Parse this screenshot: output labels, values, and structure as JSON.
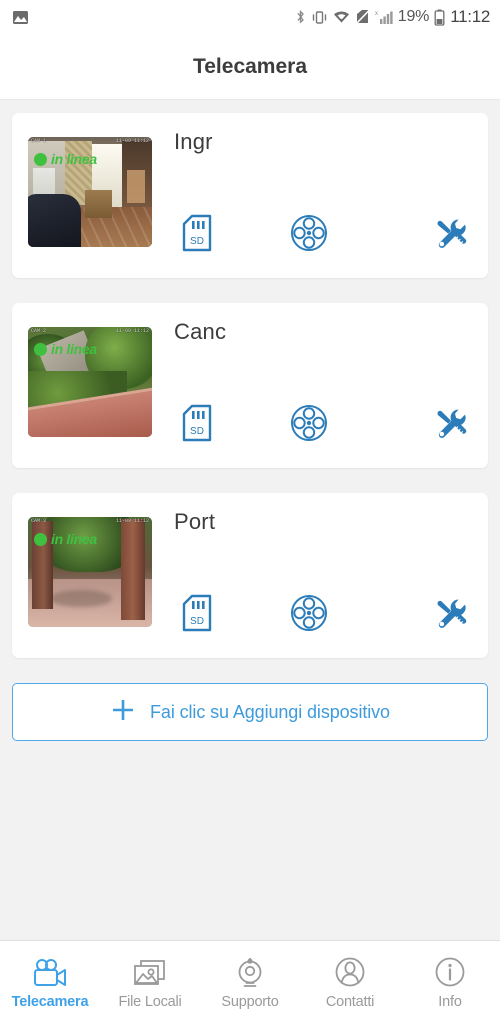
{
  "status_bar": {
    "left_icons": [
      "image-icon"
    ],
    "right_icons": [
      "bluetooth-icon",
      "vibrate-icon",
      "wifi-icon",
      "no-sim-icon",
      "signal-icon"
    ],
    "battery_percent": "19%",
    "time": "11:12"
  },
  "header": {
    "title": "Telecamera"
  },
  "theme": {
    "accent_blue": "#3d9bdc",
    "icon_blue": "#2b7cb8",
    "nav_active_blue": "#3fa2e8",
    "online_green": "#3fc13f",
    "page_bg": "#f2f2f2",
    "card_bg": "#ffffff",
    "text_dark": "#3c3c3c",
    "text_muted": "#9a9a9a"
  },
  "devices": [
    {
      "name": "Ingr",
      "status_text": "in linea",
      "status_color": "#3fc13f",
      "scene": "sc-indoor",
      "osd_left": "CAM 1",
      "osd_right": "11-09 11:12",
      "actions": [
        {
          "name": "sd-card-icon",
          "label": "SD"
        },
        {
          "name": "ptz-control-icon",
          "label": ""
        },
        {
          "name": "tools-icon",
          "label": ""
        }
      ]
    },
    {
      "name": "Canc",
      "status_text": "in linea",
      "status_color": "#3fc13f",
      "scene": "sc-garden",
      "osd_left": "CAM 2",
      "osd_right": "11-09 11:12",
      "actions": [
        {
          "name": "sd-card-icon",
          "label": "SD"
        },
        {
          "name": "ptz-control-icon",
          "label": ""
        },
        {
          "name": "tools-icon",
          "label": ""
        }
      ]
    },
    {
      "name": "Port",
      "status_text": "in linea",
      "status_color": "#3fc13f",
      "scene": "sc-gate",
      "osd_left": "CAM 3",
      "osd_right": "11-09 11:12",
      "actions": [
        {
          "name": "sd-card-icon",
          "label": "SD"
        },
        {
          "name": "ptz-control-icon",
          "label": ""
        },
        {
          "name": "tools-icon",
          "label": ""
        }
      ]
    }
  ],
  "add_device": {
    "label": "Fai clic su Aggiungi dispositivo",
    "icon": "plus-icon"
  },
  "bottom_nav": {
    "items": [
      {
        "label": "Telecamera",
        "icon": "video-camera-icon",
        "active": true
      },
      {
        "label": "File Locali",
        "icon": "photos-icon",
        "active": false
      },
      {
        "label": "Supporto",
        "icon": "webcam-icon",
        "active": false
      },
      {
        "label": "Contatti",
        "icon": "person-icon",
        "active": false
      },
      {
        "label": "Info",
        "icon": "info-icon",
        "active": false
      }
    ]
  }
}
